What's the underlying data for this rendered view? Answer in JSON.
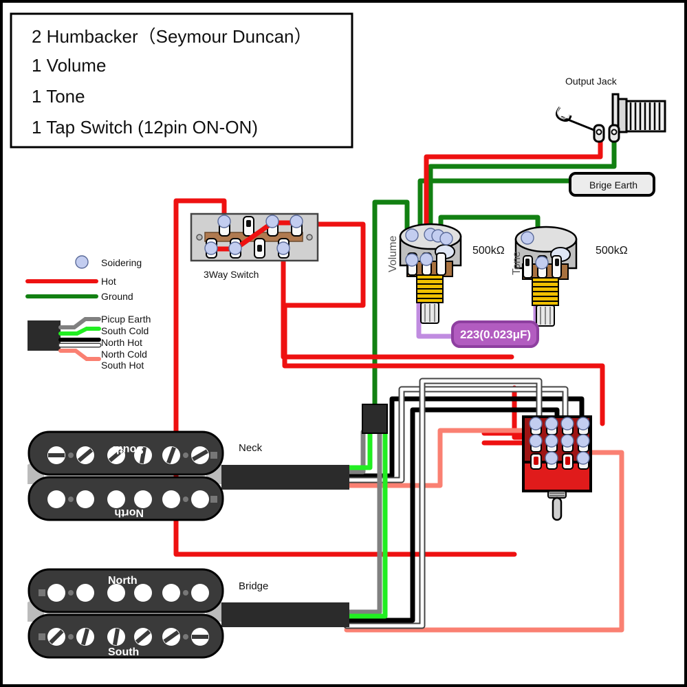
{
  "diagram": {
    "title_box": {
      "lines": [
        "2 Humbacker（Seymour Duncan）",
        "1 Volume",
        "1 Tone",
        "1 Tap Switch (12pin ON-ON)"
      ]
    },
    "legend": {
      "soldering_label": "Soidering",
      "hot_label": "Hot",
      "ground_label": "Ground",
      "pickup_wires": [
        {
          "label": "Picup Earth",
          "color": "#808080"
        },
        {
          "label": "South Cold",
          "color": "#22ee22"
        },
        {
          "label": "North Hot",
          "color": "#000000"
        },
        {
          "label": "North Cold",
          "color": "#ffffff"
        },
        {
          "label": "South Hot",
          "color": "#fa8072"
        }
      ]
    },
    "components": {
      "output_jack": "Output Jack",
      "bridge_earth": "Brige Earth",
      "three_way_switch": "3Way Switch",
      "volume_pot": {
        "label": "Volume",
        "value": "500kΩ"
      },
      "tone_pot": {
        "label": "Tone",
        "value": "500kΩ"
      },
      "capacitor": "223(0.023μF)",
      "neck_pickup": {
        "label": "Neck",
        "top_coil": "South",
        "bottom_coil": "North"
      },
      "bridge_pickup": {
        "label": "Bridge",
        "top_coil": "North",
        "bottom_coil": "South"
      }
    },
    "colors": {
      "hot": "#ee1111",
      "ground": "#128012",
      "pickup_earth": "#808080",
      "south_cold": "#22ee22",
      "north_hot": "#000000",
      "north_cold": "#ffffff",
      "south_hot": "#fa8072",
      "cap_wire": "#c08ce0",
      "cap_body": "#b25cc0",
      "tap_switch_body": "#e01b1b",
      "tap_switch_panel": "#9e1414",
      "solder": "#c3cdf0",
      "pot_body": "#c0c0c0",
      "pot_top": "#e0e0e0",
      "pot_thread": "#f0c000",
      "pickup_body": "#3a3a3a",
      "switch_plate": "#d0d0d0",
      "switch_bar": "#b07a50"
    }
  }
}
